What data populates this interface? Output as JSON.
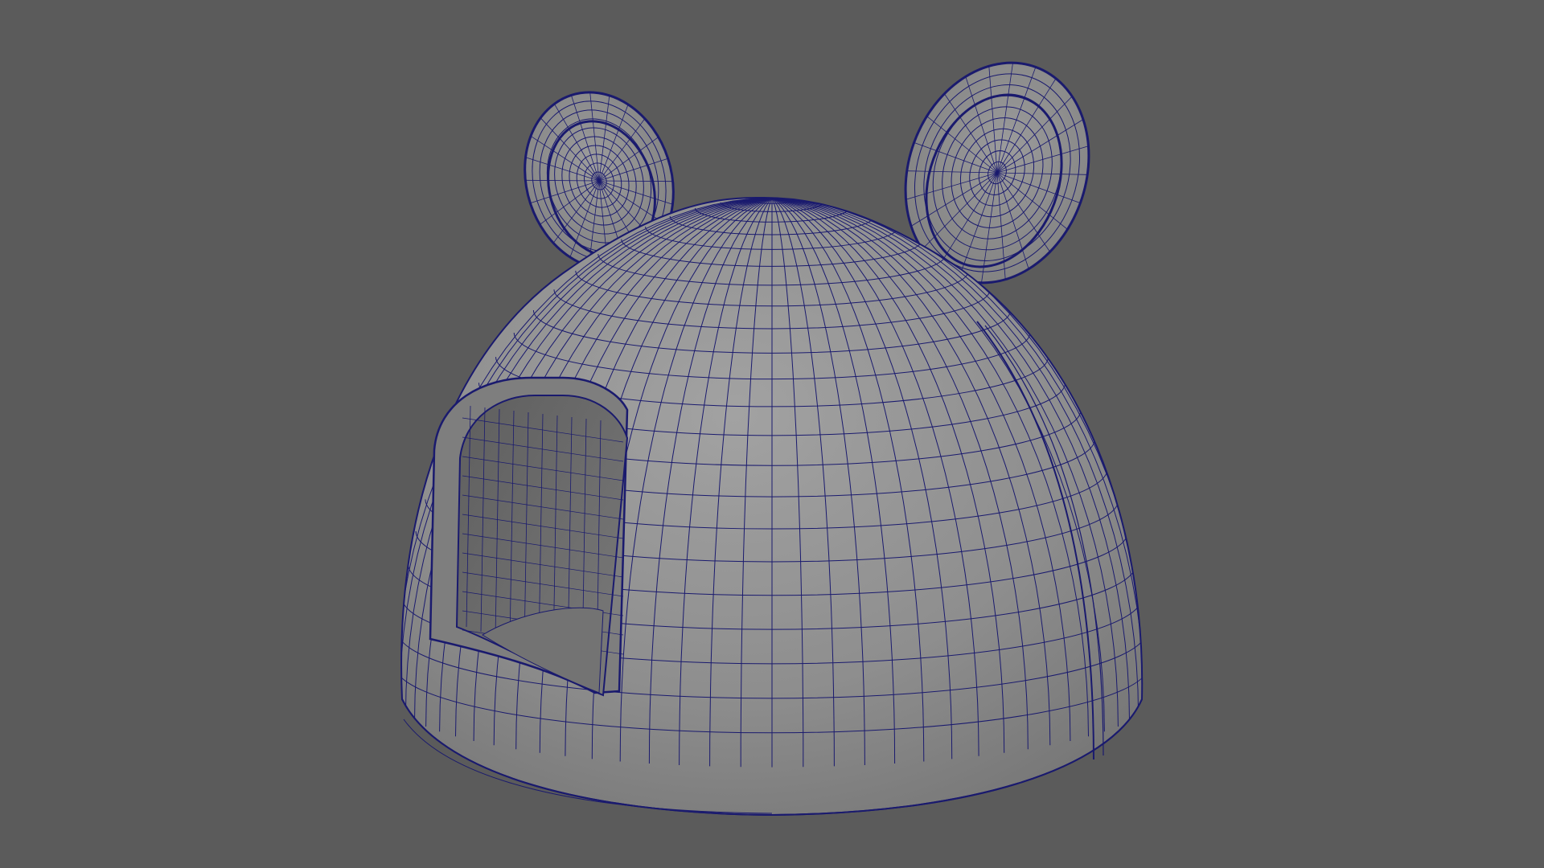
{
  "viewport": {
    "background": "#5b5b5b"
  },
  "model": {
    "subject": "mouse-house-igloo",
    "surface_color": "#8f8f8f",
    "wire_color": "#1a1a6e",
    "interior_color": "#6e6e6e"
  }
}
